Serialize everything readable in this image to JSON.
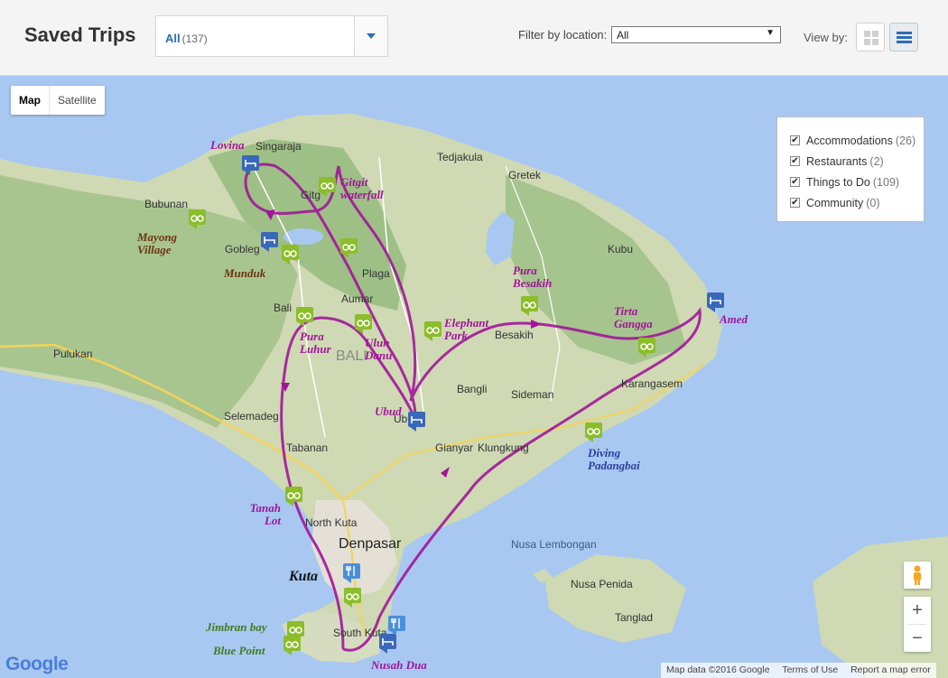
{
  "header": {
    "title": "Saved Trips",
    "trip_filter": {
      "value": "All",
      "count": "(137)"
    },
    "location_filter": {
      "label": "Filter by location:",
      "value": "All"
    },
    "view_by_label": "View by:"
  },
  "map": {
    "type_controls": {
      "map": "Map",
      "satellite": "Satellite"
    },
    "legend": [
      {
        "label": "Accommodations",
        "count": "(26)"
      },
      {
        "label": "Restaurants",
        "count": "(2)"
      },
      {
        "label": "Things to Do",
        "count": "(109)"
      },
      {
        "label": "Community",
        "count": "(0)"
      }
    ],
    "places": {
      "singaraja": "Singaraja",
      "tedjakula": "Tedjakula",
      "gretek": "Gretek",
      "bubunan": "Bubunan",
      "gobleg": "Gobleg",
      "kubu": "Kubu",
      "plaga": "Plaga",
      "aumar": "Aumar",
      "bali": "Bali",
      "bali_region": "BALI",
      "besakih": "Besakih",
      "pulukan": "Pulukan",
      "bangli": "Bangli",
      "sideman": "Sideman",
      "karangasem": "Karangasem",
      "selemadeg": "Selemadeg",
      "tabanan": "Tabanan",
      "gianyar": "Gianyar",
      "klungkung": "Klungkung",
      "north_kuta": "North Kuta",
      "denpasar": "Denpasar",
      "nusa_lembongan": "Nusa Lembongan",
      "nusa_penida": "Nusa Penida",
      "tanglad": "Tanglad",
      "south_kuta": "South Kuta",
      "gitg": "Gitg",
      "ub": "Ub"
    },
    "callouts": {
      "lovina": "Lovina",
      "gitgit": "Gitgit waterfall",
      "mayong": "Mayong Village",
      "munduk": "Munduk",
      "pura_besakih": "Pura Besakih",
      "tirta_gangga": "Tirta Gangga",
      "amed": "Amed",
      "elephant_park": "Elephant Park",
      "pura_luhur": "Pura Luhur",
      "ulun_danu": "Ulun Danu",
      "ubud": "Ubud",
      "diving": "Diving Padangbai",
      "tanah_lot": "Tanah Lot",
      "kuta": "Kuta",
      "jimbran": "Jimbran bay",
      "blue_point": "Blue Point",
      "nusah_dua": "Nusah Dua"
    },
    "google_logo": "Google",
    "attribution": {
      "data": "Map data ©2016 Google",
      "terms": "Terms of Use",
      "report": "Report a map error"
    },
    "icons": {
      "accommodation": "bed-icon",
      "restaurant": "fork-knife-icon",
      "thing_to_do": "binoculars-icon",
      "pegman": "pegman-icon"
    },
    "colors": {
      "route": "#a1159a",
      "accommodation": "#3a68b8",
      "thing_to_do": "#8cbd2a",
      "restaurant": "#4a90d9"
    }
  }
}
